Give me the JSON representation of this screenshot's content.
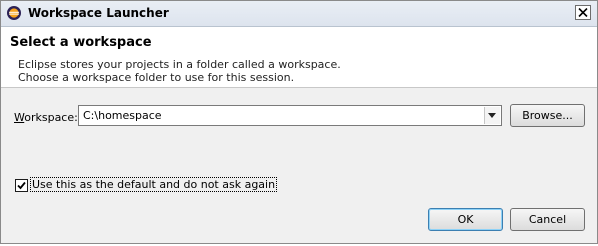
{
  "window": {
    "title": "Workspace Launcher",
    "icon": "eclipse-icon"
  },
  "header": {
    "title": "Select a workspace",
    "description_line1": "Eclipse stores your projects in a folder called a workspace.",
    "description_line2": "Choose a workspace folder to use for this session."
  },
  "workspace": {
    "label_mnemonic": "W",
    "label_rest": "orkspace:",
    "value": "C:\\homespace",
    "browse_label": "Browse..."
  },
  "options": {
    "default_checked": true,
    "default_label": "Use this as the default and do not ask again"
  },
  "buttons": {
    "ok": "OK",
    "cancel": "Cancel"
  },
  "colors": {
    "dialog_bg": "#f0f0f0",
    "header_bg": "#ffffff",
    "titlebar_bg": "#dde4ee"
  }
}
